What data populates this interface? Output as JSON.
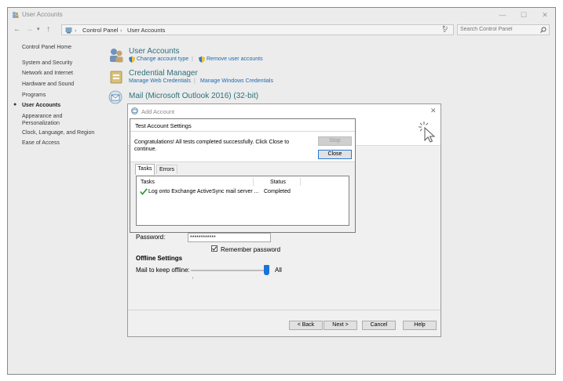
{
  "control_panel": {
    "title": "User Accounts",
    "window_buttons": {
      "minimize": "—",
      "maximize": "☐",
      "close": "✕"
    },
    "breadcrumb": [
      "Control Panel",
      "User Accounts"
    ],
    "search_placeholder": "Search Control Panel",
    "sidebar": [
      "Control Panel Home",
      "System and Security",
      "Network and Internet",
      "Hardware and Sound",
      "Programs",
      "User Accounts",
      "Appearance and",
      "Personalization",
      "Clock, Language, and Region",
      "Ease of Access"
    ],
    "sections": {
      "user_accounts": {
        "title": "User Accounts",
        "links": [
          "Change account type",
          "Remove user accounts"
        ]
      },
      "credential_manager": {
        "title": "Credential Manager",
        "links": [
          "Manage Web Credentials",
          "Manage Windows Credentials"
        ]
      },
      "mail": {
        "title": "Mail (Microsoft Outlook 2016) (32-bit)"
      }
    }
  },
  "add_account": {
    "title": "Add Account",
    "close_glyph": "✕",
    "password_label": "Password:",
    "password_value": "************",
    "remember_label": "Remember password",
    "remember_checked": true,
    "offline_heading": "Offline Settings",
    "offline_label": "Mail to keep offline:",
    "offline_value_label": "All",
    "offline_level": 1.0,
    "buttons": {
      "back": "< Back",
      "next": "Next >",
      "cancel": "Cancel",
      "help": "Help"
    }
  },
  "test_dialog": {
    "title": "Test Account Settings",
    "message": "Congratulations! All tests completed successfully. Click Close to continue.",
    "stop_label": "Stop",
    "close_label": "Close",
    "tabs": [
      "Tasks",
      "Errors"
    ],
    "columns": [
      "Tasks",
      "Status"
    ],
    "rows": [
      {
        "task": "Log onto Exchange ActiveSync mail server ...",
        "status": "Completed"
      }
    ]
  }
}
